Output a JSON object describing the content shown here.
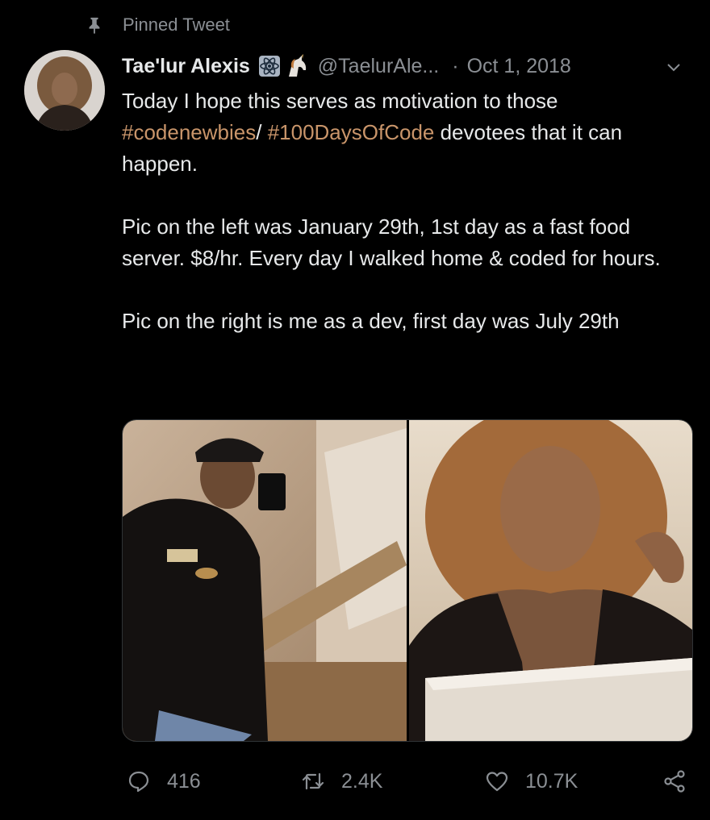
{
  "pinned": {
    "label": "Pinned Tweet",
    "icon": "pin-icon"
  },
  "author": {
    "display_name": "Tae'lur Alexis",
    "handle": "@TaelurAle...",
    "badges": [
      "atom-icon",
      "unicorn-icon"
    ]
  },
  "timestamp": "Oct 1, 2018",
  "separator": "·",
  "tweet": {
    "line1_part1": "Today I hope this serves as motivation to those ",
    "hashtag1": "#codenewbies",
    "slash": "/ ",
    "hashtag2": "#100DaysOfCode",
    "line1_part2": " devotees that it can happen.",
    "para2": "Pic on the left was January 29th, 1st day as a fast food server. $8/hr. Every day I walked home & coded for hours.",
    "para3": "Pic on the right is me as a dev, first day was July 29th"
  },
  "actions": {
    "replies": "416",
    "retweets": "2.4K",
    "likes": "10.7K"
  },
  "colors": {
    "background": "#000000",
    "text": "#e7e9ea",
    "muted": "#8b8f94",
    "hashtag": "#c9956a"
  }
}
